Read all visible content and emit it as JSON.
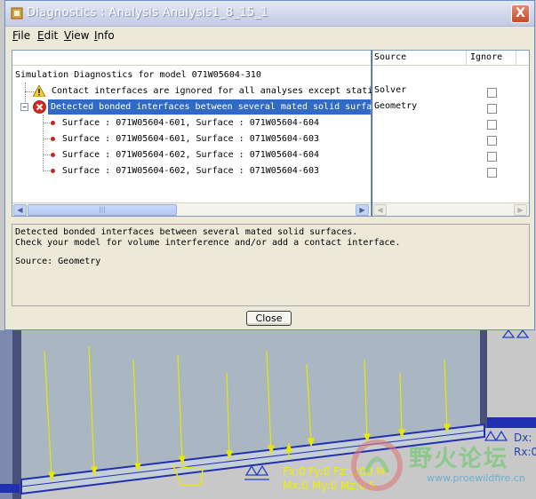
{
  "window": {
    "title": "Diagnostics : Analysis Analysis1_8_15_1",
    "close_glyph": "X"
  },
  "menu": [
    {
      "label": "File",
      "accel": "F",
      "rest": "ile"
    },
    {
      "label": "Edit",
      "accel": "E",
      "rest": "dit"
    },
    {
      "label": "View",
      "accel": "V",
      "rest": "iew"
    },
    {
      "label": "Info",
      "accel": "I",
      "rest": "nfo"
    }
  ],
  "tree": {
    "root": "Simulation Diagnostics for model 071W05604-310",
    "warning_item": "Contact interfaces are ignored for all analyses except stati",
    "error_item": "Detected bonded interfaces between several mated solid surfac",
    "children": [
      "Surface : 071W05604-601, Surface : 071W05604-604",
      "Surface : 071W05604-601, Surface : 071W05604-603",
      "Surface : 071W05604-602, Surface : 071W05604-604",
      "Surface : 071W05604-602, Surface : 071W05604-603"
    ],
    "expander_glyph": "−"
  },
  "columns": {
    "source": "Source",
    "ignore": "Ignore"
  },
  "rows": [
    {
      "source": "Solver",
      "ignored": false
    },
    {
      "source": "Geometry",
      "ignored": false
    },
    {
      "source": "",
      "ignored": false
    },
    {
      "source": "",
      "ignored": false
    },
    {
      "source": "",
      "ignored": false
    },
    {
      "source": "",
      "ignored": false
    }
  ],
  "details": {
    "line1": "Detected bonded interfaces between several mated solid surfaces.",
    "line2": "Check your model for volume interference and/or add a contact interface.",
    "source_line": "Source: Geometry"
  },
  "buttons": {
    "close": "Close"
  },
  "scroll": {
    "left_arrow": "◀",
    "right_arrow": "▶",
    "grip": "|||"
  },
  "viewport": {
    "load_line1": "Fx:0 Fy:0 Fz:-200 M",
    "load_line2": "Mx:0 My:0 Mz:0 S",
    "corner_line1": "Dx:",
    "corner_line2": "Rx:0",
    "watermark_cn": "野火论坛",
    "watermark_url": "www.proewildfire.cn",
    "colors": {
      "beam": "#b8c4cc",
      "load": "#f0f000",
      "constraint": "#2040c8"
    }
  }
}
